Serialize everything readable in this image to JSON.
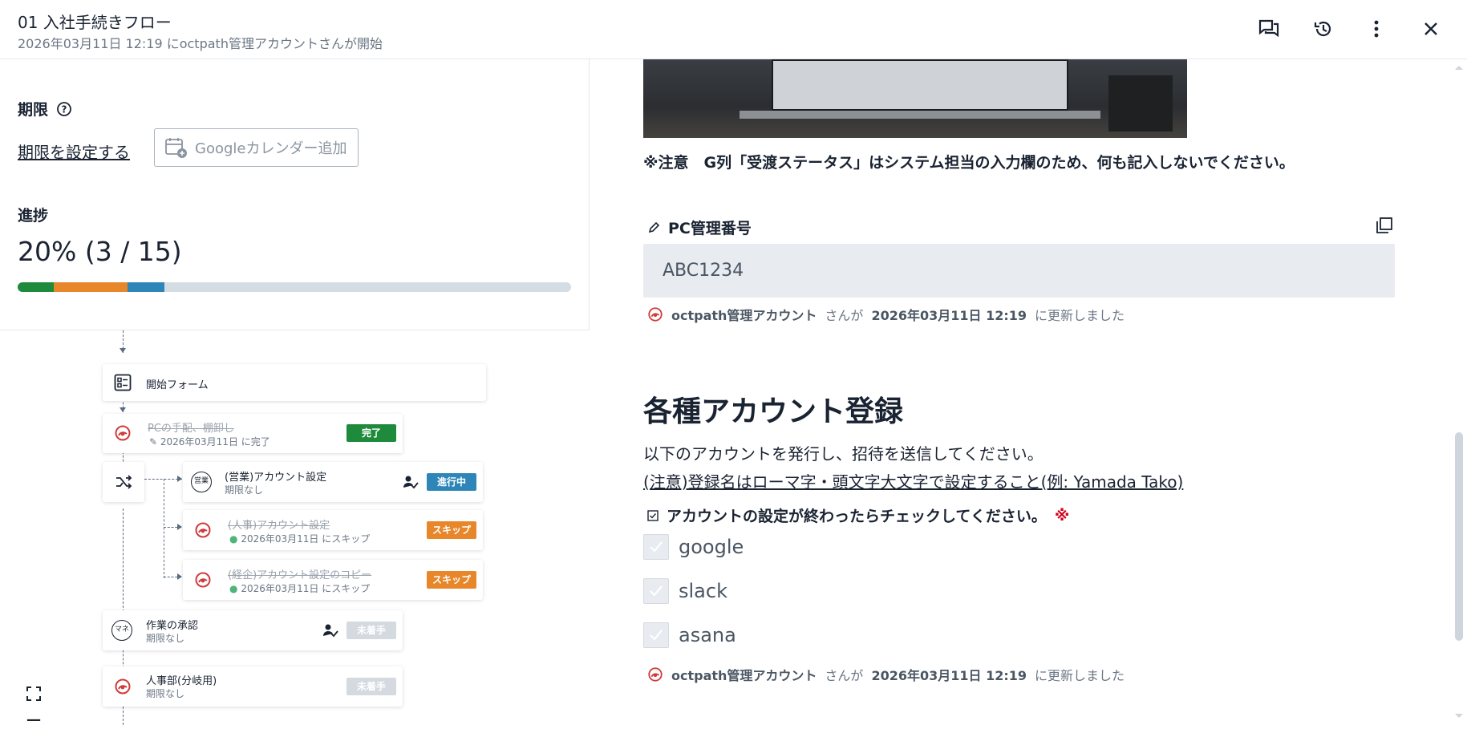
{
  "header": {
    "title": "01 入社手続きフロー",
    "subtitle": "2026年03月11日 12:19 にoctpath管理アカウントさんが開始"
  },
  "left": {
    "deadline_label": "期限",
    "set_deadline_link": "期限を設定する",
    "gcal_button": "Googleカレンダー追加",
    "progress_label": "進捗",
    "progress_text": "20% (3 / 15)",
    "progress_fraction": 0.2,
    "progress_segments": [
      {
        "color": "#1e8a3c",
        "fraction": 0.065
      },
      {
        "color": "#e8872a",
        "fraction": 0.133
      },
      {
        "color": "#2e86b8",
        "fraction": 0.067
      }
    ]
  },
  "flow": {
    "nodes": [
      {
        "title": "開始フォーム"
      },
      {
        "title": "PCの手配、棚卸し",
        "sub": "2026年03月11日 に完了",
        "badge": "完了"
      },
      {
        "title": "(営業)アカウント設定",
        "sub": "期限なし",
        "badge": "進行中",
        "avatar": "営業"
      },
      {
        "title": "(人事)アカウント設定",
        "sub": "2026年03月11日 にスキップ",
        "badge": "スキップ"
      },
      {
        "title": "(経企)アカウント設定のコピー",
        "sub": "2026年03月11日 にスキップ",
        "badge": "スキップ"
      },
      {
        "title": "作業の承認",
        "sub": "期限なし",
        "badge": "未着手",
        "avatar": "マネ"
      },
      {
        "title": "人事部(分岐用)",
        "sub": "期限なし",
        "badge": "未着手"
      }
    ],
    "zoom_in": "+",
    "zoom_out": "−"
  },
  "right": {
    "note": "※注意　G列「受渡ステータス」はシステム担当の入力欄のため、何も記入しないでください。",
    "field_label": "PC管理番号",
    "field_value": "ABC1234",
    "meta1": {
      "user": "octpath管理アカウント",
      "san": "さんが",
      "date": "2026年03月11日 12:19",
      "suffix": "に更新しました"
    },
    "section_title": "各種アカウント登録",
    "desc1": "以下のアカウントを発行し、招待を送信してください。",
    "desc2": "(注意)登録名はローマ字・頭文字大文字で設定すること(例: Yamada Tako)",
    "check_label": "アカウントの設定が終わったらチェックしてください。",
    "required_mark": "※",
    "checkboxes": [
      {
        "label": "google",
        "checked": true
      },
      {
        "label": "slack",
        "checked": true
      },
      {
        "label": "asana",
        "checked": true
      }
    ],
    "meta2": {
      "user": "octpath管理アカウント",
      "san": "さんが",
      "date": "2026年03月11日 12:19",
      "suffix": "に更新しました"
    }
  }
}
